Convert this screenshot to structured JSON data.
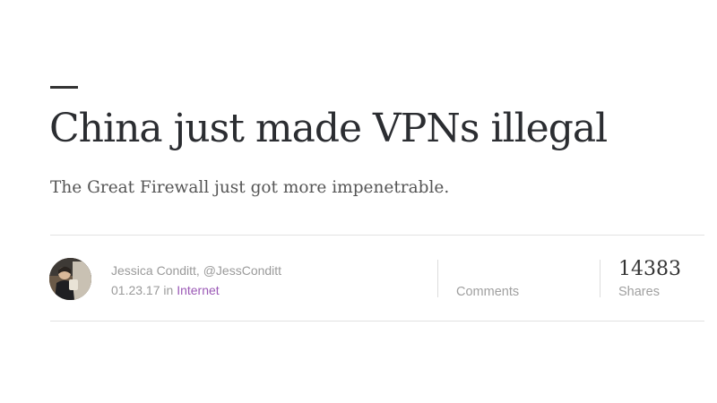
{
  "article": {
    "headline": "China just made VPNs illegal",
    "subhead": "The Great Firewall just got more impenetrable."
  },
  "byline": {
    "author": "Jessica Conditt, @JessConditt",
    "date": "01.23.17",
    "in_word": "in",
    "category": "Internet",
    "category_color": "#9b59b6"
  },
  "stats": {
    "comments_label": "Comments",
    "shares_count": "14383",
    "shares_label": "Shares"
  }
}
